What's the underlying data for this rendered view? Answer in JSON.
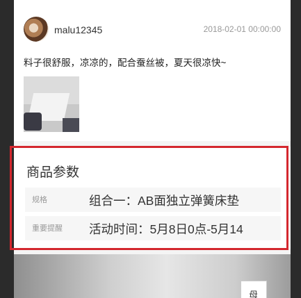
{
  "review": {
    "username": "malu12345",
    "date": "2018-02-01 00:00:00",
    "text": "料子很舒服，凉凉的，配合蚕丝被，夏天很凉快~"
  },
  "params": {
    "title": "商品参数",
    "rows": [
      {
        "label": "规格",
        "value": "组合一：AB面独立弹簧床垫"
      },
      {
        "label": "重要提醒",
        "value": "活动时间：5月8日0点-5月14"
      }
    ]
  },
  "banner": {
    "badge_text": "母"
  }
}
